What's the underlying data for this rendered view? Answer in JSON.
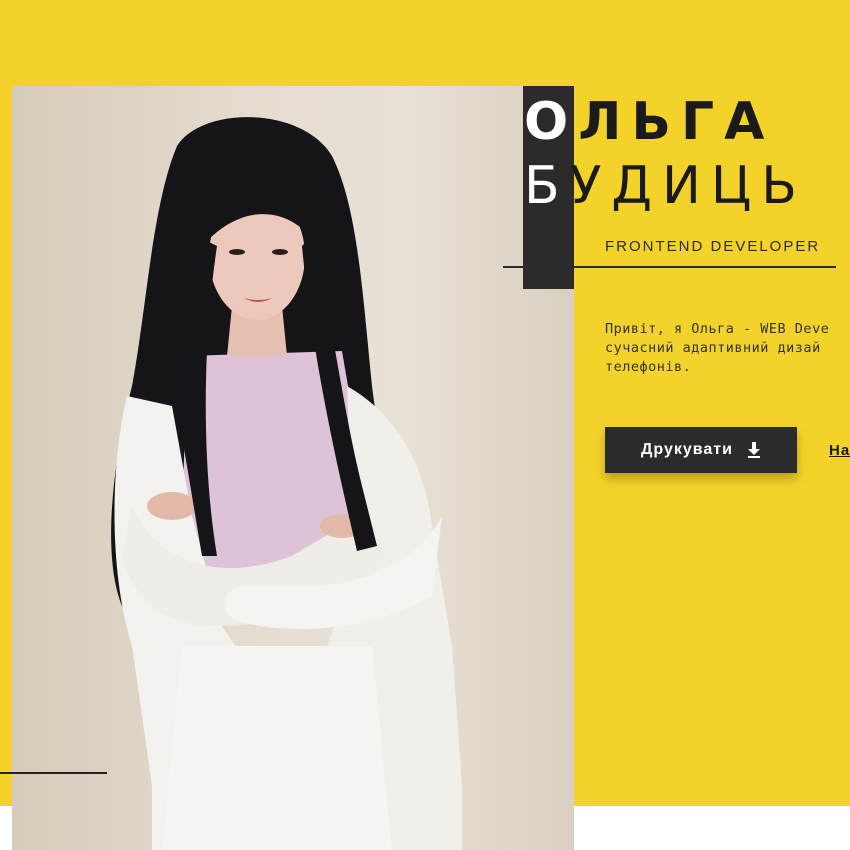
{
  "hero": {
    "name_first_initial": "О",
    "name_first_rest": "ЛЬГА",
    "name_last_initial": "Б",
    "name_last_rest": "УДИЦЬ",
    "role": "FRONTEND DEVELOPER",
    "intro_lines": [
      "Привіт, я Ольга - WEB Deve",
      "сучасний адаптивний дизай",
      "телефонів."
    ],
    "print_button_label": "Друкувати",
    "print_button_icon": "download-icon",
    "contact_link_label": "На"
  },
  "colors": {
    "accent_yellow": "#f3d329",
    "dark": "#2b2b2b",
    "background": "#ffffff"
  },
  "photo": {
    "icon": "portrait-photo"
  }
}
